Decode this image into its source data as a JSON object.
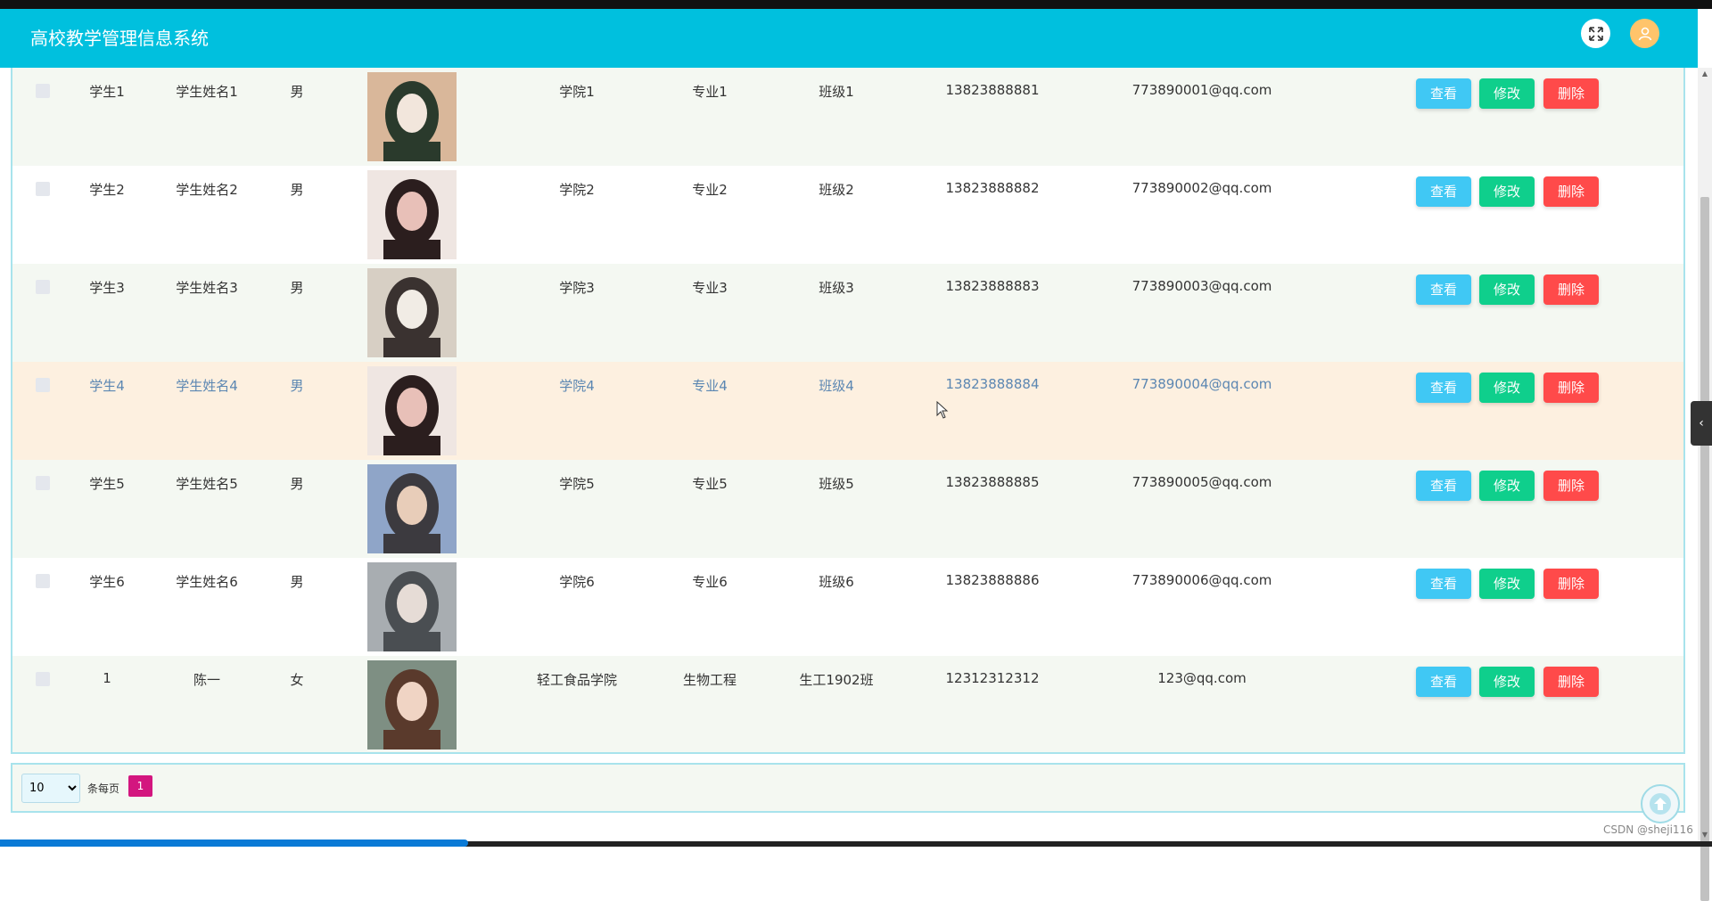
{
  "header": {
    "title": "高校教学管理信息系统"
  },
  "table": {
    "actions": {
      "view": "查看",
      "edit": "修改",
      "delete": "删除"
    },
    "rows": [
      {
        "id": "学生1",
        "name": "学生姓名1",
        "gender": "男",
        "college": "学院1",
        "major": "专业1",
        "class": "班级1",
        "phone": "13823888881",
        "email": "773890001@qq.com"
      },
      {
        "id": "学生2",
        "name": "学生姓名2",
        "gender": "男",
        "college": "学院2",
        "major": "专业2",
        "class": "班级2",
        "phone": "13823888882",
        "email": "773890002@qq.com"
      },
      {
        "id": "学生3",
        "name": "学生姓名3",
        "gender": "男",
        "college": "学院3",
        "major": "专业3",
        "class": "班级3",
        "phone": "13823888883",
        "email": "773890003@qq.com"
      },
      {
        "id": "学生4",
        "name": "学生姓名4",
        "gender": "男",
        "college": "学院4",
        "major": "专业4",
        "class": "班级4",
        "phone": "13823888884",
        "email": "773890004@qq.com"
      },
      {
        "id": "学生5",
        "name": "学生姓名5",
        "gender": "男",
        "college": "学院5",
        "major": "专业5",
        "class": "班级5",
        "phone": "13823888885",
        "email": "773890005@qq.com"
      },
      {
        "id": "学生6",
        "name": "学生姓名6",
        "gender": "男",
        "college": "学院6",
        "major": "专业6",
        "class": "班级6",
        "phone": "13823888886",
        "email": "773890006@qq.com"
      },
      {
        "id": "1",
        "name": "陈一",
        "gender": "女",
        "college": "轻工食品学院",
        "major": "生物工程",
        "class": "生工1902班",
        "phone": "12312312312",
        "email": "123@qq.com"
      }
    ]
  },
  "pagination": {
    "page_size": "10",
    "per_page_label": "条每页",
    "current_page": "1"
  },
  "watermark": "CSDN @sheji116",
  "colors": {
    "header": "#00c0de",
    "view": "#40c8f4",
    "edit": "#0fcf8c",
    "delete": "#ff4a4a",
    "page": "#d3167f"
  }
}
